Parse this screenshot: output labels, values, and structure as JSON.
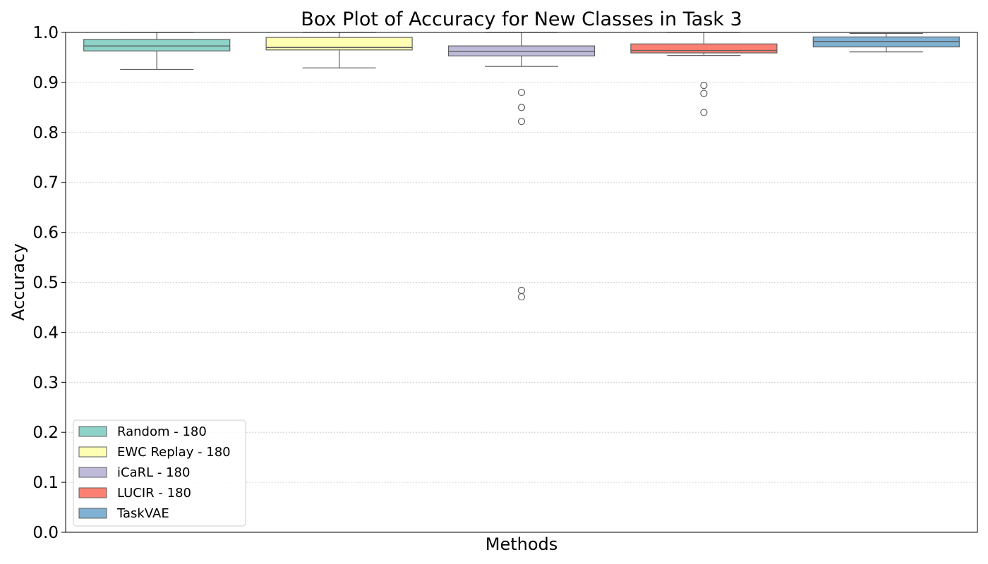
{
  "chart_data": {
    "type": "box",
    "title": "Box Plot of Accuracy for New Classes in Task 3",
    "xlabel": "Methods",
    "ylabel": "Accuracy",
    "ylim": [
      0,
      1.0
    ],
    "yticks": [
      "0.0",
      "0.1",
      "0.2",
      "0.3",
      "0.4",
      "0.5",
      "0.6",
      "0.7",
      "0.8",
      "0.9",
      "1.0"
    ],
    "grid": "horizontal dotted",
    "legend_position": "lower-left",
    "series": [
      {
        "name": "Random - 180",
        "color": "#8dd3c7",
        "whisker_low": 0.926,
        "q1": 0.963,
        "median": 0.973,
        "q3": 0.986,
        "whisker_high": 1.0,
        "outliers": []
      },
      {
        "name": "EWC Replay - 180",
        "color": "#ffffb3",
        "whisker_low": 0.929,
        "q1": 0.965,
        "median": 0.97,
        "q3": 0.99,
        "whisker_high": 1.0,
        "outliers": []
      },
      {
        "name": "iCaRL - 180",
        "color": "#bebada",
        "whisker_low": 0.932,
        "q1": 0.953,
        "median": 0.962,
        "q3": 0.973,
        "whisker_high": 1.0,
        "outliers": [
          0.88,
          0.85,
          0.822,
          0.484,
          0.471
        ]
      },
      {
        "name": "LUCIR - 180",
        "color": "#fb8072",
        "whisker_low": 0.954,
        "q1": 0.959,
        "median": 0.964,
        "q3": 0.977,
        "whisker_high": 1.0,
        "outliers": [
          0.894,
          0.878,
          0.84
        ]
      },
      {
        "name": "TaskVAE",
        "color": "#80b1d3",
        "whisker_low": 0.961,
        "q1": 0.971,
        "median": 0.982,
        "q3": 0.991,
        "whisker_high": 0.998,
        "outliers": []
      }
    ]
  }
}
